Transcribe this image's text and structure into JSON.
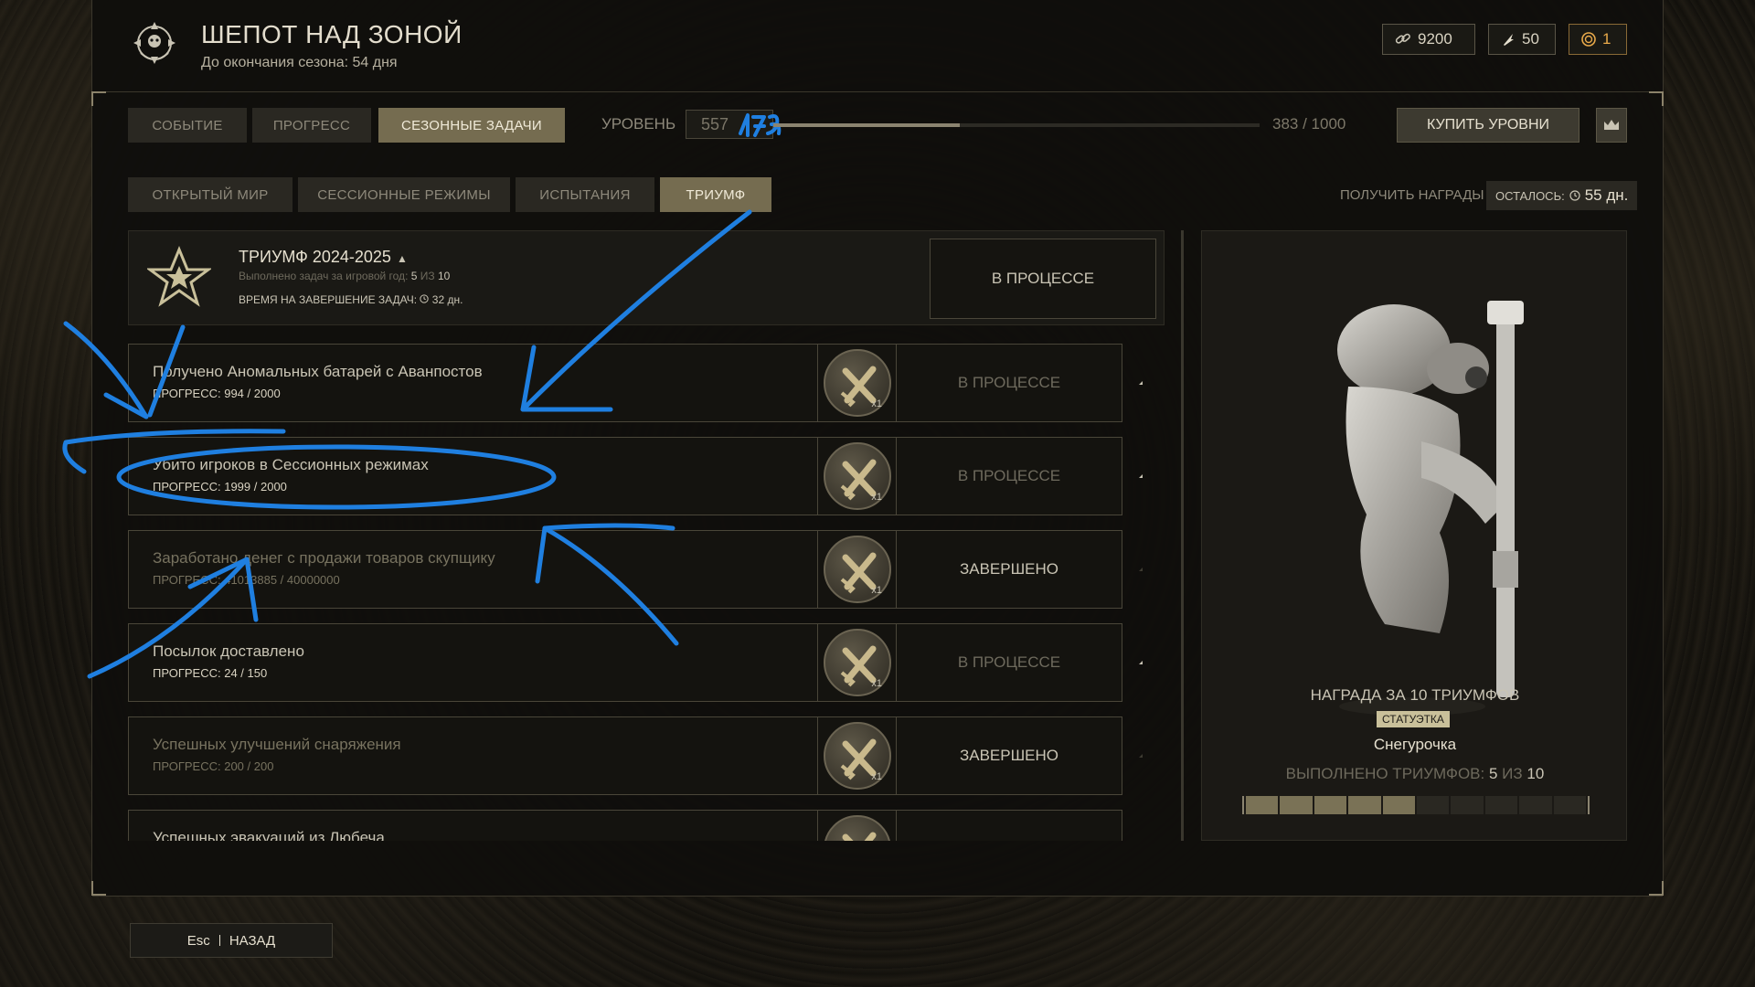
{
  "header": {
    "title": "ШЕПОТ НАД ЗОНОЙ",
    "subtitle": "До окончания сезона: 54 дня",
    "currencies": [
      {
        "value": "9200",
        "icon": "link-chain-icon"
      },
      {
        "value": "50",
        "icon": "feather-token-icon"
      },
      {
        "value": "1",
        "icon": "gold-coin-icon",
        "color": "#e8a94a"
      }
    ]
  },
  "top_tabs": [
    {
      "label": "СОБЫТИЕ",
      "active": false
    },
    {
      "label": "ПРОГРЕСС",
      "active": false
    },
    {
      "label": "СЕЗОННЫЕ ЗАДАЧИ",
      "active": true
    }
  ],
  "level": {
    "label": "УРОВЕНЬ",
    "value": "557",
    "handwritten": "179",
    "progress_text": "383 / 1000",
    "progress_fraction": 0.383,
    "buy_label": "КУПИТЬ УРОВНИ"
  },
  "sub_tabs": [
    {
      "label": "ОТКРЫТЫЙ МИР",
      "active": false
    },
    {
      "label": "СЕССИОННЫЕ РЕЖИМЫ",
      "active": false
    },
    {
      "label": "ИСПЫТАНИЯ",
      "active": false
    },
    {
      "label": "ТРИУМФ",
      "active": true
    }
  ],
  "rewards": {
    "get_label": "ПОЛУЧИТЬ НАГРАДЫ",
    "remaining_label": "ОСТАЛОСЬ:",
    "remaining_value": "55 дн."
  },
  "triumph": {
    "title": "ТРИУМФ 2024-2025",
    "done_label": "Выполнено задач за игровой год:",
    "done_value": "5",
    "done_of": "ИЗ",
    "done_total": "10",
    "time_label": "ВРЕМЯ НА ЗАВЕРШЕНИЕ ЗАДАЧ:",
    "time_value": "32 дн.",
    "status": "В ПРОЦЕССЕ"
  },
  "tasks": [
    {
      "name": "Получено Аномальных батарей с Аванпостов",
      "progress": "ПРОГРЕСС: 994 / 2000",
      "reward_qty": "x1",
      "status": "В ПРОЦЕССЕ",
      "done": false
    },
    {
      "name": "Убито игроков в Сессионных режимах",
      "progress": "ПРОГРЕСС: 1999 / 2000",
      "reward_qty": "x1",
      "status": "В ПРОЦЕССЕ",
      "done": false
    },
    {
      "name": "Заработано денег с продажи товаров скупщику",
      "progress": "ПРОГРЕСС: 41013885 / 40000000",
      "reward_qty": "x1",
      "status": "ЗАВЕРШЕНО",
      "done": true
    },
    {
      "name": "Посылок доставлено",
      "progress": "ПРОГРЕСС: 24 / 150",
      "reward_qty": "x1",
      "status": "В ПРОЦЕССЕ",
      "done": false
    },
    {
      "name": "Успешных улучшений снаряжения",
      "progress": "ПРОГРЕСС: 200 / 200",
      "reward_qty": "x1",
      "status": "ЗАВЕРШЕНО",
      "done": true
    },
    {
      "name": "Успешных эвакуаций из Любеча",
      "progress": "",
      "reward_qty": "",
      "status": "",
      "done": false
    }
  ],
  "reward_panel": {
    "title": "НАГРАДА ЗА 10 ТРИУМФОВ",
    "badge": "СТАТУЭТКА",
    "name": "Снегурочка",
    "done_label": "ВЫПОЛНЕНО ТРИУМФОВ:",
    "done_value": "5",
    "done_of": "ИЗ",
    "done_total": "10",
    "segments_total": 10,
    "segments_filled": 5
  },
  "footer": {
    "esc_key": "Esc",
    "back_label": "НАЗАД"
  },
  "colors": {
    "accent": "#756c50",
    "annotation": "#1f7fe0"
  }
}
